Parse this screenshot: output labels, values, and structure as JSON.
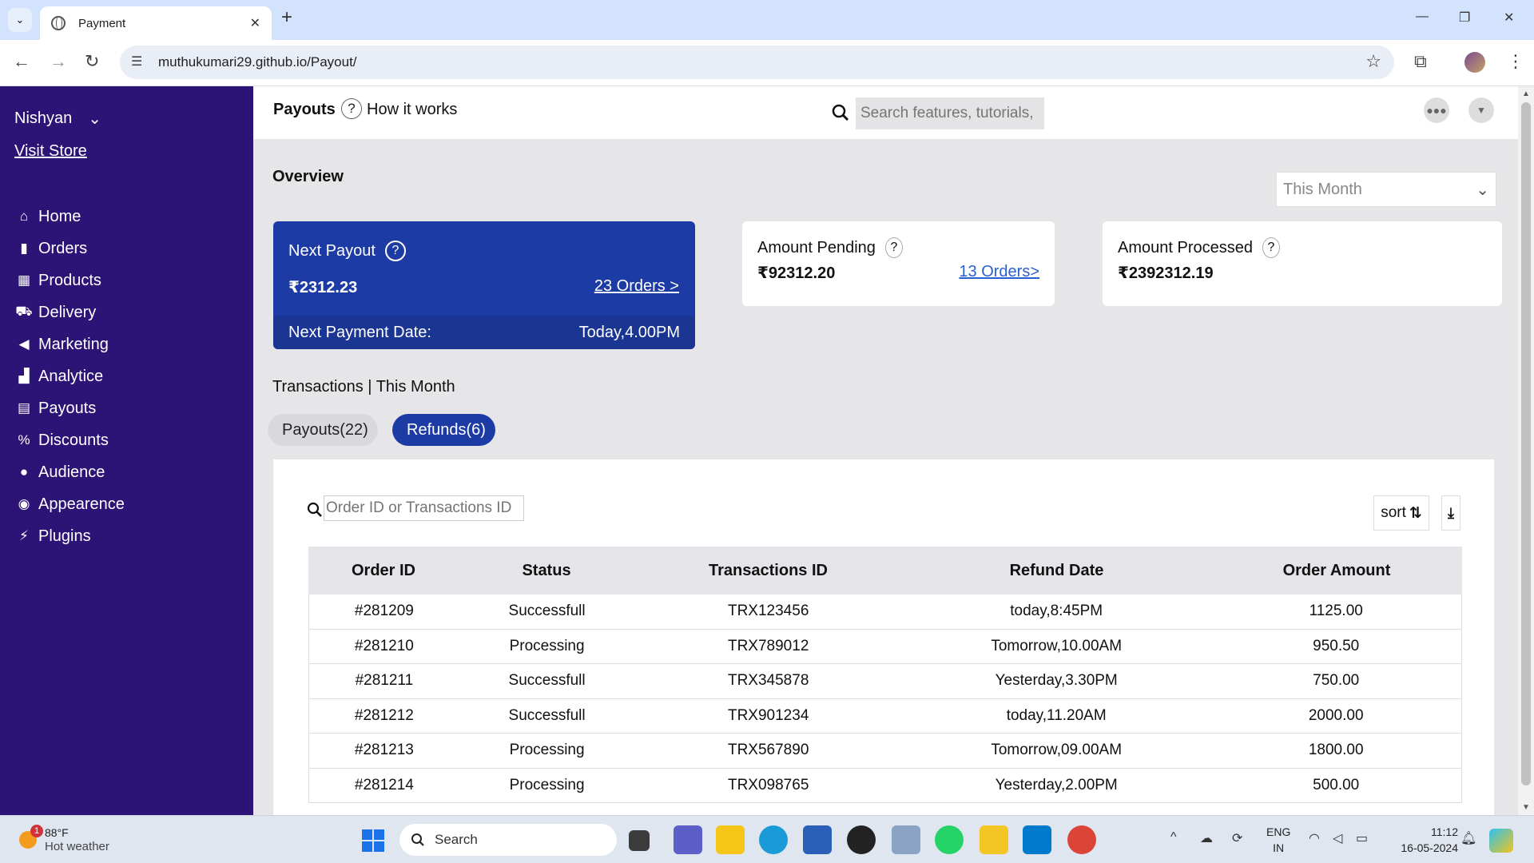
{
  "browser": {
    "tab_title": "Payment",
    "new_tab_label": "+",
    "url": "muthukumari29.github.io/Payout/"
  },
  "sidebar": {
    "user": "Nishyan",
    "visit_store": "Visit Store",
    "items": [
      {
        "icon": "home-icon",
        "glyph": "⌂",
        "label": "Home"
      },
      {
        "icon": "orders-icon",
        "glyph": "▮",
        "label": "Orders"
      },
      {
        "icon": "products-icon",
        "glyph": "▦",
        "label": "Products"
      },
      {
        "icon": "delivery-icon",
        "glyph": "⛟",
        "label": "Delivery"
      },
      {
        "icon": "marketing-icon",
        "glyph": "◀",
        "label": "Marketing"
      },
      {
        "icon": "analytics-icon",
        "glyph": "▟",
        "label": "Analytice"
      },
      {
        "icon": "payouts-icon",
        "glyph": "▤",
        "label": "Payouts"
      },
      {
        "icon": "discounts-icon",
        "glyph": "%",
        "label": "Discounts"
      },
      {
        "icon": "audience-icon",
        "glyph": "●",
        "label": "Audience"
      },
      {
        "icon": "appearance-icon",
        "glyph": "◉",
        "label": "Appearence"
      },
      {
        "icon": "plugins-icon",
        "glyph": "⚡",
        "label": "Plugins"
      }
    ]
  },
  "topbar": {
    "title": "Payouts",
    "help": "?",
    "how_it_works": "How it works",
    "search_placeholder": "Search features, tutorials,"
  },
  "overview": {
    "title": "Overview",
    "period": "This Month",
    "next_payout": {
      "label": "Next Payout",
      "help": "?",
      "amount": "₹2312.23",
      "orders_link": "23 Orders >",
      "date_label": "Next Payment Date:",
      "date_value": "Today,4.00PM"
    },
    "amount_pending": {
      "label": "Amount Pending",
      "help": "?",
      "amount": "₹92312.20",
      "orders_link": "13 Orders>"
    },
    "amount_processed": {
      "label": "Amount Processed",
      "help": "?",
      "amount": "₹2392312.19"
    }
  },
  "transactions": {
    "heading": "Transactions | This Month",
    "tab_payouts": "Payouts(22)",
    "tab_refunds": "Refunds(6)",
    "search_placeholder": "Order ID or Transactions ID",
    "sort_label": "sort",
    "columns": [
      "Order ID",
      "Status",
      "Transactions ID",
      "Refund Date",
      "Order Amount"
    ],
    "rows": [
      [
        "#281209",
        "Successfull",
        "TRX123456",
        "today,8:45PM",
        "1125.00"
      ],
      [
        "#281210",
        "Processing",
        "TRX789012",
        "Tomorrow,10.00AM",
        "950.50"
      ],
      [
        "#281211",
        "Successfull",
        "TRX345878",
        "Yesterday,3.30PM",
        "750.00"
      ],
      [
        "#281212",
        "Successfull",
        "TRX901234",
        "today,11.20AM",
        "2000.00"
      ],
      [
        "#281213",
        "Processing",
        "TRX567890",
        "Tomorrow,09.00AM",
        "1800.00"
      ],
      [
        "#281214",
        "Processing",
        "TRX098765",
        "Yesterday,2.00PM",
        "500.00"
      ]
    ]
  },
  "taskbar": {
    "weather_badge": "1",
    "temperature": "88°F",
    "weather_text": "Hot weather",
    "search_label": "Search",
    "lang_1": "ENG",
    "lang_2": "IN",
    "time": "11:12",
    "date": "16-05-2024"
  },
  "colors": {
    "sidebar_bg": "#2c1477",
    "primary": "#1d3ba5",
    "link": "#2a5fd0",
    "page_bg": "#e6e6e9"
  }
}
